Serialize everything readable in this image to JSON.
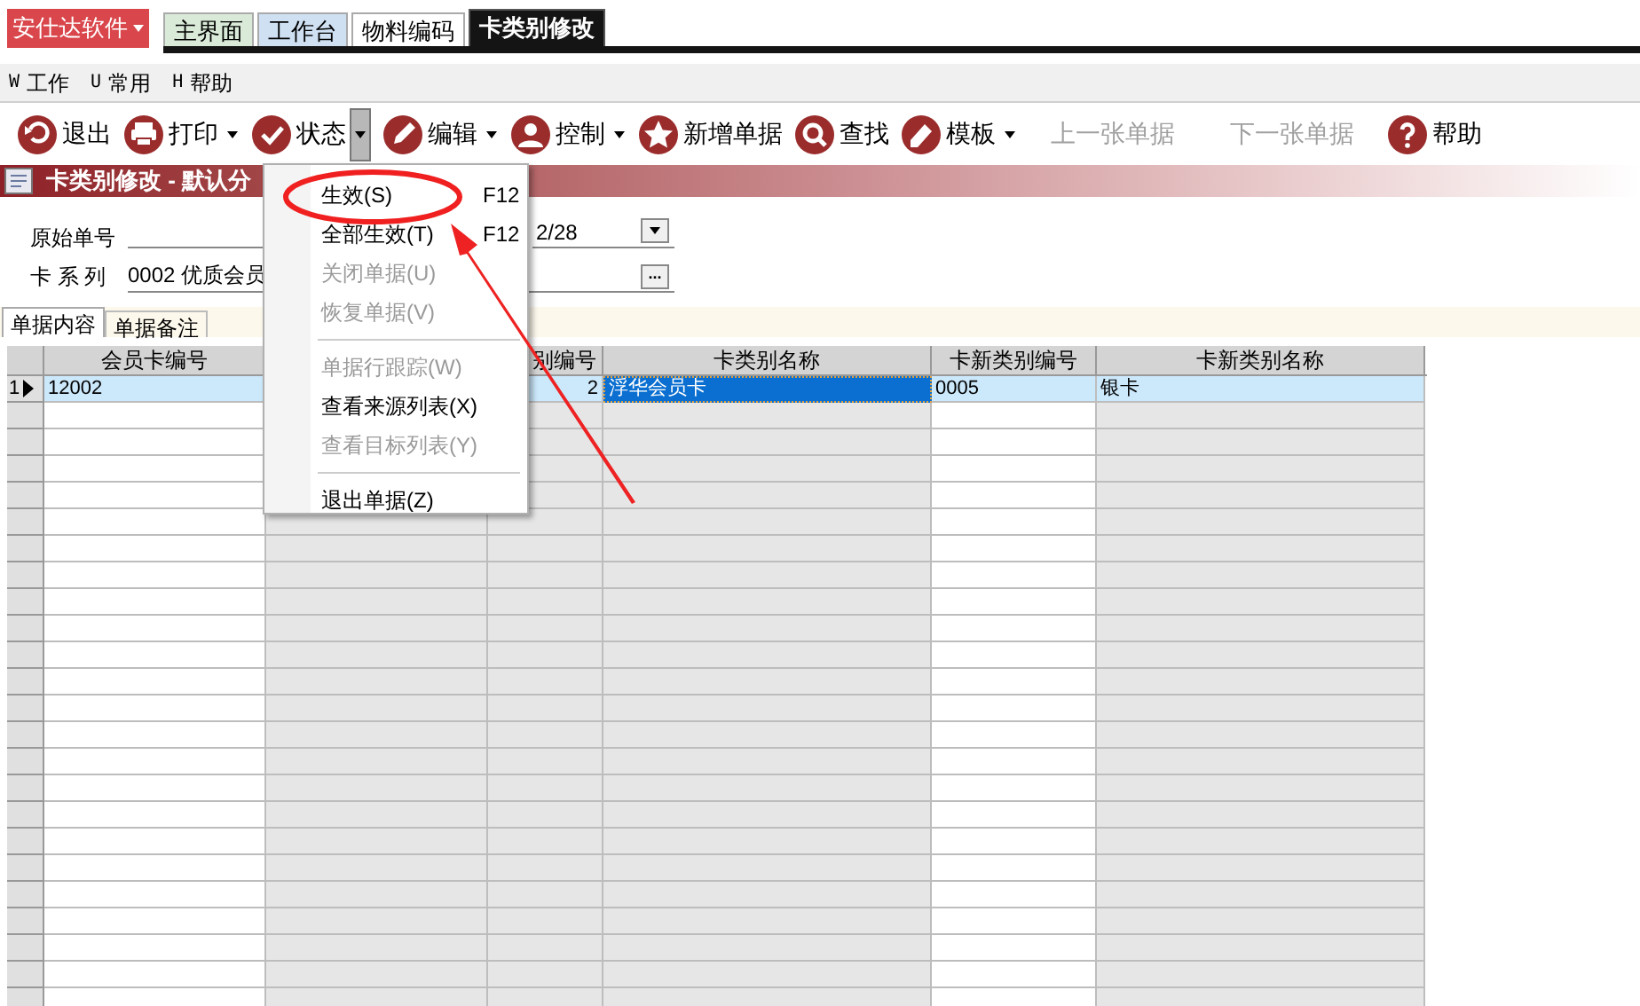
{
  "brand": {
    "label": "安仕达软件"
  },
  "tabs": [
    {
      "label": "主界面",
      "selected": false,
      "color": "#d9ead8"
    },
    {
      "label": "工作台",
      "selected": false,
      "color": "#cfe0f3"
    },
    {
      "label": "物料编码",
      "selected": false,
      "color": "#ffffff"
    },
    {
      "label": "卡类别修改",
      "selected": true,
      "color": "#141414"
    }
  ],
  "menu_bar": [
    {
      "key": "W",
      "label": "工作"
    },
    {
      "key": "U",
      "label": "常用"
    },
    {
      "key": "H",
      "label": "帮助"
    }
  ],
  "toolbar": [
    {
      "kind": "button",
      "label": "退出",
      "disabled": false
    },
    {
      "kind": "dropdown",
      "label": "打印",
      "disabled": false,
      "expanded": false
    },
    {
      "kind": "dropdown",
      "label": "状态",
      "disabled": false,
      "expanded": true
    },
    {
      "kind": "dropdown",
      "label": "编辑",
      "disabled": false,
      "expanded": false
    },
    {
      "kind": "dropdown",
      "label": "控制",
      "disabled": false,
      "expanded": false
    },
    {
      "kind": "button",
      "label": "新增单据",
      "disabled": false
    },
    {
      "kind": "button",
      "label": "查找",
      "disabled": false
    },
    {
      "kind": "dropdown",
      "label": "模板",
      "disabled": false,
      "expanded": false
    },
    {
      "kind": "button",
      "label": "上一张单据",
      "disabled": true
    },
    {
      "kind": "button",
      "label": "下一张单据",
      "disabled": true
    },
    {
      "kind": "button",
      "label": "帮助",
      "disabled": false
    }
  ],
  "doc_title": "卡类别修改 - 默认分",
  "form": {
    "original_no_label": "原始单号",
    "date_value": "2/28",
    "series_label": "卡 系 列",
    "series_value": "0002 优质会员",
    "browse_button": "..."
  },
  "doc_tabs": [
    {
      "label": "单据内容",
      "selected": true
    },
    {
      "label": "单据备注",
      "selected": false
    }
  ],
  "table": {
    "columns": [
      {
        "label": "会员卡编号"
      },
      {},
      {
        "label": "别编号"
      },
      {
        "label": "卡类别名称"
      },
      {
        "label": "卡新类别编号"
      },
      {
        "label": "卡新类别名称"
      }
    ],
    "rows": [
      {
        "number": "1",
        "selected": true,
        "cells": [
          "12002",
          "",
          "2",
          "浮华会员卡",
          "0005",
          "银卡"
        ]
      }
    ]
  },
  "context_menu": [
    {
      "kind": "item",
      "label": "生效(S)",
      "shortcut": "F12",
      "disabled": false
    },
    {
      "kind": "item",
      "label": "全部生效(T)",
      "shortcut": "F12",
      "disabled": false
    },
    {
      "kind": "item",
      "label": "关闭单据(U)",
      "disabled": true
    },
    {
      "kind": "item",
      "label": "恢复单据(V)",
      "disabled": true
    },
    {
      "kind": "separator"
    },
    {
      "kind": "item",
      "label": "单据行跟踪(W)",
      "disabled": true
    },
    {
      "kind": "item",
      "label": "查看来源列表(X)",
      "disabled": false
    },
    {
      "kind": "item",
      "label": "查看目标列表(Y)",
      "disabled": true
    },
    {
      "kind": "separator"
    },
    {
      "kind": "item",
      "label": "退出单据(Z)",
      "disabled": false
    }
  ]
}
